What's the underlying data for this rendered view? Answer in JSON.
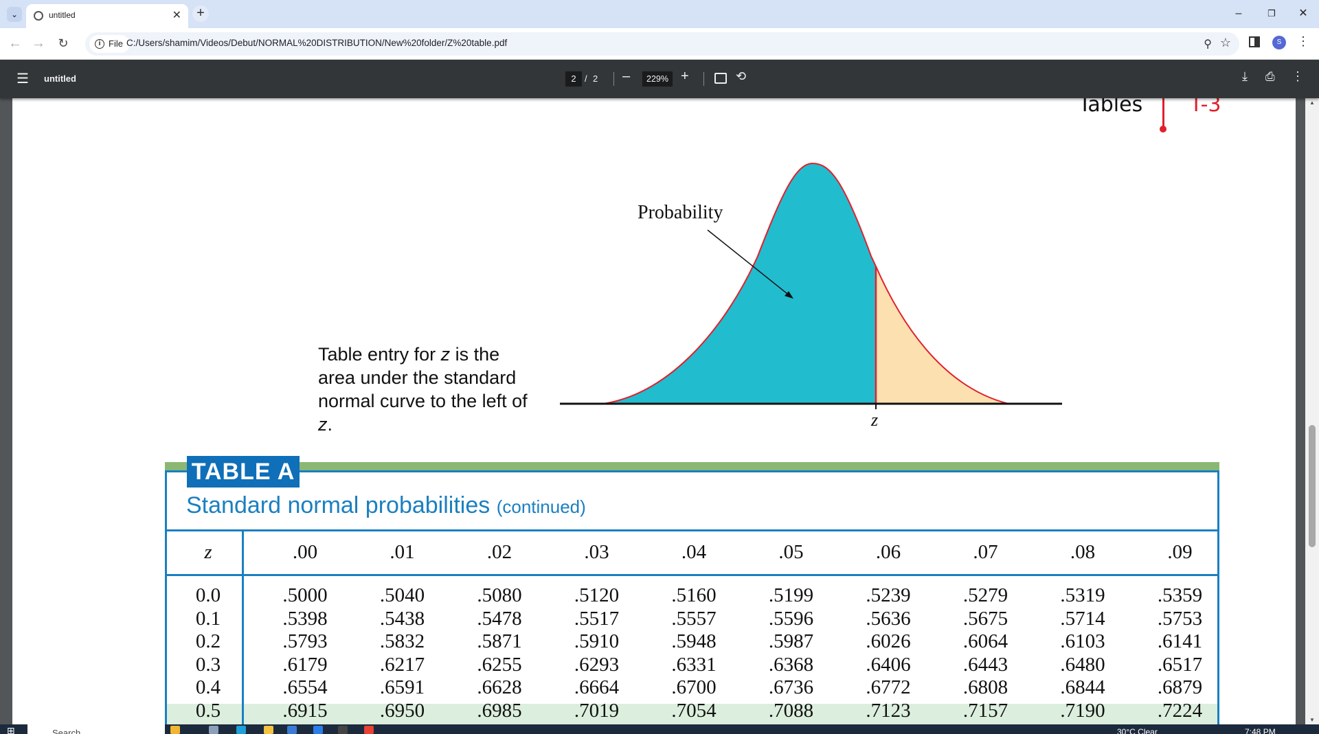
{
  "browser": {
    "tab_title": "untitled",
    "address_chip": "File",
    "url": "C:/Users/shamim/Videos/Debut/NORMAL%20DISTRIBUTION/New%20folder/Z%20table.pdf",
    "profile_initial": "S"
  },
  "pdf_viewer": {
    "title": "untitled",
    "page_current": "2",
    "page_separator": "/",
    "page_total": "2",
    "zoom": "229%"
  },
  "page": {
    "running_head": "Tables",
    "page_number": "T-3",
    "figure_label": "Probability",
    "axis_marker": "z",
    "caption": "Table entry for z is the area under the standard normal curve to the left of z.",
    "table_label": "TABLE A",
    "table_title": "Standard normal probabilities",
    "table_title_note": "(continued)",
    "colors": {
      "shaded_area": "#22bccf",
      "tail_area": "#fde0b0",
      "curve": "#e0202c",
      "accent_blue": "#1a7fc1",
      "green_bar": "#8ab874"
    }
  },
  "table": {
    "z_header": "z",
    "columns": [
      ".00",
      ".01",
      ".02",
      ".03",
      ".04",
      ".05",
      ".06",
      ".07",
      ".08",
      ".09"
    ],
    "rows": [
      {
        "z": "0.0",
        "values": [
          ".5000",
          ".5040",
          ".5080",
          ".5120",
          ".5160",
          ".5199",
          ".5239",
          ".5279",
          ".5319",
          ".5359"
        ]
      },
      {
        "z": "0.1",
        "values": [
          ".5398",
          ".5438",
          ".5478",
          ".5517",
          ".5557",
          ".5596",
          ".5636",
          ".5675",
          ".5714",
          ".5753"
        ]
      },
      {
        "z": "0.2",
        "values": [
          ".5793",
          ".5832",
          ".5871",
          ".5910",
          ".5948",
          ".5987",
          ".6026",
          ".6064",
          ".6103",
          ".6141"
        ]
      },
      {
        "z": "0.3",
        "values": [
          ".6179",
          ".6217",
          ".6255",
          ".6293",
          ".6331",
          ".6368",
          ".6406",
          ".6443",
          ".6480",
          ".6517"
        ]
      },
      {
        "z": "0.4",
        "values": [
          ".6554",
          ".6591",
          ".6628",
          ".6664",
          ".6700",
          ".6736",
          ".6772",
          ".6808",
          ".6844",
          ".6879"
        ]
      },
      {
        "z": "0.5",
        "values": [
          ".6915",
          ".6950",
          ".6985",
          ".7019",
          ".7054",
          ".7088",
          ".7123",
          ".7157",
          ".7190",
          ".7224"
        ]
      }
    ]
  },
  "taskbar": {
    "search_placeholder": "Search",
    "weather": "30°C  Clear",
    "time": "7:48 PM"
  }
}
